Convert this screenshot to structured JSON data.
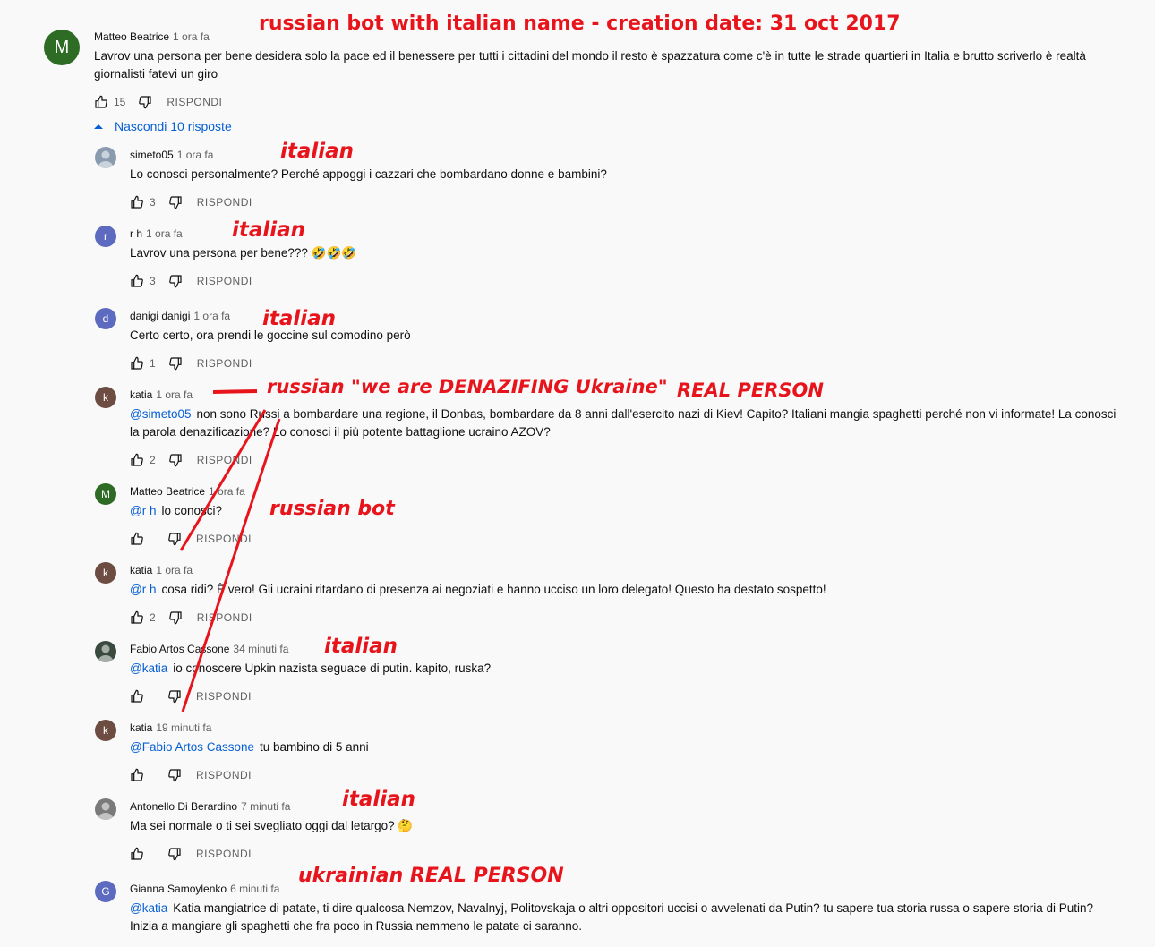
{
  "replies_toggle": {
    "label": "Nascondi 10 risposte"
  },
  "reply_label": "RISPONDI",
  "colors": {
    "accent": "#065fd4",
    "annotation": "#e8141c"
  },
  "top_comment": {
    "author": "Matteo Beatrice",
    "time": "1 ora fa",
    "avatar_letter": "M",
    "avatar_color": "#2e6b24",
    "text_line1": "Lavrov una persona per bene desidera solo la pace ed il benessere per tutti i cittadini del mondo il resto è spazzatura come c'è in tutte le strade quartieri in Italia e brutto scriverlo è realtà",
    "text_line2": "giornalisti fatevi un giro",
    "likes": "15"
  },
  "replies": [
    {
      "author": "simeto05",
      "time": "1 ora fa",
      "avatar_letter": "",
      "avatar_color": "#8a9bb0",
      "mention": "",
      "text": "Lo conosci personalmente? Perché appoggi i cazzari che bombardano donne e bambini?",
      "likes": "3"
    },
    {
      "author": "r h",
      "time": "1 ora fa",
      "avatar_letter": "r",
      "avatar_color": "#5c6bc0",
      "mention": "",
      "text": "Lavrov una persona per bene??? 🤣🤣🤣",
      "likes": "3"
    },
    {
      "author": "danigi danigi",
      "time": "1 ora fa",
      "avatar_letter": "d",
      "avatar_color": "#5c6bc0",
      "mention": "",
      "text": "Certo certo, ora prendi le goccine sul comodino però",
      "likes": "1"
    },
    {
      "author": "katia",
      "time": "1 ora fa",
      "avatar_letter": "k",
      "avatar_color": "#6d4c41",
      "mention": "@simeto05",
      "text": "non sono Russi a bombardare una regione, il Donbas, bombardare da 8 anni dall'esercito nazi di Kiev! Capito? Italiani mangia spaghetti perché non vi informate! La conosci",
      "text_line2": "la parola denazificazione? Lo conosci il più potente battaglione ucraino AZOV?",
      "likes": "2"
    },
    {
      "author": "Matteo Beatrice",
      "time": "1 ora fa",
      "avatar_letter": "M",
      "avatar_color": "#2e6b24",
      "mention": "@r h",
      "text": "lo conosci?",
      "likes": ""
    },
    {
      "author": "katia",
      "time": "1 ora fa",
      "avatar_letter": "k",
      "avatar_color": "#6d4c41",
      "mention": "@r h",
      "text": "cosa ridi? È vero! Gli ucraini ritardano di presenza ai negoziati e hanno ucciso un loro delegato! Questo ha destato sospetto!",
      "likes": "2"
    },
    {
      "author": "Fabio Artos Cassone",
      "time": "34 minuti fa",
      "avatar_letter": "",
      "avatar_color": "#3b4a3f",
      "mention": "@katia",
      "text": "io conoscere Upkin nazista seguace di putin. kapito, ruska?",
      "likes": ""
    },
    {
      "author": "katia",
      "time": "19 minuti fa",
      "avatar_letter": "k",
      "avatar_color": "#6d4c41",
      "mention": "@Fabio Artos Cassone",
      "text": "tu bambino di 5 anni",
      "likes": ""
    },
    {
      "author": "Antonello Di Berardino",
      "time": "7 minuti fa",
      "avatar_letter": "",
      "avatar_color": "#7a7a7a",
      "mention": "",
      "text": "Ma sei normale o ti sei svegliato oggi dal letargo? 🤔",
      "likes": ""
    },
    {
      "author": "Gianna Samoylenko",
      "time": "6 minuti fa",
      "avatar_letter": "G",
      "avatar_color": "#5c6bc0",
      "mention": "@katia",
      "text": "Katia mangiatrice di patate, ti dire qualcosa Nemzov, Navalnyj, Politovskaja o altri oppositori uccisi o avvelenati da Putin? tu sapere tua storia russa o sapere storia di Putin?",
      "text_line2": "Inizia a mangiare gli spaghetti che fra poco in Russia nemmeno le patate ci saranno.",
      "likes": ""
    }
  ],
  "annotations": {
    "top": "russian bot with italian name - creation date:  31 oct 2017",
    "italian": "italian",
    "denazifing": "russian \"we are DENAZIFING Ukraine\"",
    "real_person": "REAL PERSON",
    "russian_bot": "russian bot",
    "ukrainian": "ukrainian REAL PERSON"
  }
}
